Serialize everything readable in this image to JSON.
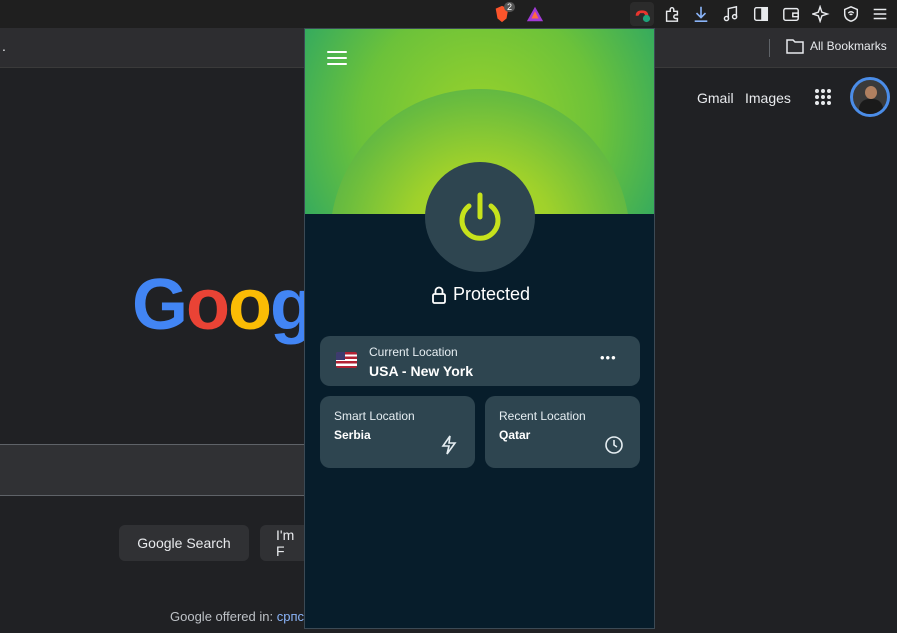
{
  "browser": {
    "brave_badge": "2",
    "bookmarks_label": "All Bookmarks",
    "colors": {
      "toolbar": "#1f1f1f",
      "bookmarks_bar": "#2d2d30"
    },
    "toolbar_icons": [
      "brave-shields-icon",
      "brave-rewards-icon",
      "vpn-extension-icon",
      "extensions-icon",
      "download-icon",
      "music-icon",
      "sidebar-icon",
      "wallet-icon",
      "leo-ai-icon",
      "brave-vpn-icon",
      "menu-icon"
    ]
  },
  "google": {
    "gmail": "Gmail",
    "images": "Images",
    "logo_text": "Goog",
    "search_button": "Google Search",
    "lucky_button": "I'm F",
    "offered_in": "Google offered in:",
    "offered_lang": "српс"
  },
  "vpn": {
    "status": "Protected",
    "current": {
      "label": "Current Location",
      "value": "USA - New York",
      "more": "•••"
    },
    "smart": {
      "label": "Smart Location",
      "value": "Serbia"
    },
    "recent": {
      "label": "Recent Location",
      "value": "Qatar"
    },
    "colors": {
      "background": "#071d2b",
      "card": "#2e4550",
      "power": "#c7e21c",
      "hero": "#9fd12b"
    }
  }
}
